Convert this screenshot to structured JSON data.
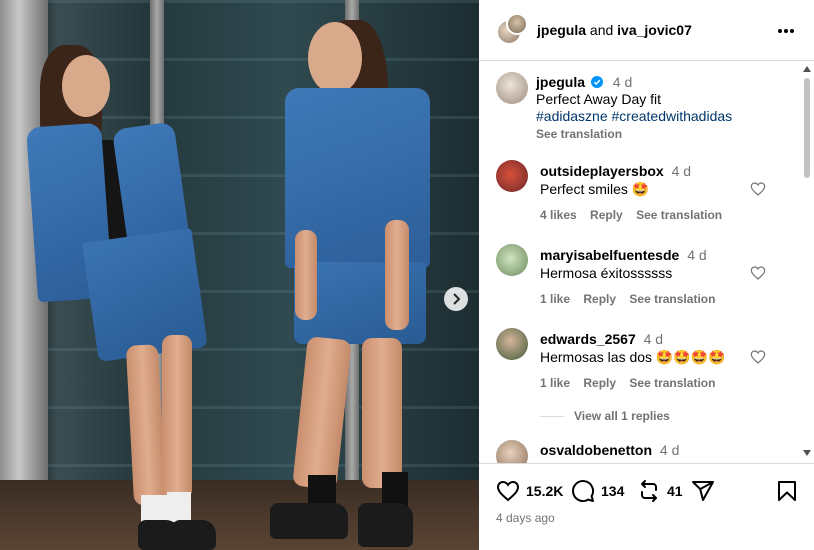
{
  "post": {
    "authors": {
      "primary": "jpegula",
      "joiner": "and",
      "secondary": "iva_jovic07"
    },
    "caption": {
      "username": "jpegula",
      "time": "4 d",
      "text": "Perfect Away Day fit",
      "hashtags": "#adidaszne #createdwithadidas",
      "see_translation": "See translation"
    },
    "comments": [
      {
        "username": "outsideplayersbox",
        "time": "4 d",
        "text": "Perfect smiles 🤩",
        "likes": "4 likes",
        "reply": "Reply",
        "see_translation": "See translation"
      },
      {
        "username": "maryisabelfuentesde",
        "time": "4 d",
        "text": "Hermosa éxitossssss",
        "likes": "1 like",
        "reply": "Reply",
        "see_translation": "See translation"
      },
      {
        "username": "edwards_2567",
        "time": "4 d",
        "text": "Hermosas las dos 🤩🤩🤩🤩",
        "likes": "1 like",
        "reply": "Reply",
        "see_translation": "See translation",
        "view_replies": "View all 1 replies"
      },
      {
        "username": "osvaldobenetton",
        "time": "4 d"
      }
    ],
    "stats": {
      "likes": "15.2K",
      "comments": "134",
      "reposts": "41"
    },
    "posted": "4 days ago"
  },
  "colors": {
    "hashtag": "#00376b",
    "muted": "#737373",
    "divider": "#dbdbdb",
    "verified": "#0095f6"
  },
  "icons": [
    "more-icon",
    "verified-badge-icon",
    "heart-icon",
    "comment-icon",
    "repost-icon",
    "share-icon",
    "save-icon",
    "chevron-right-icon"
  ]
}
